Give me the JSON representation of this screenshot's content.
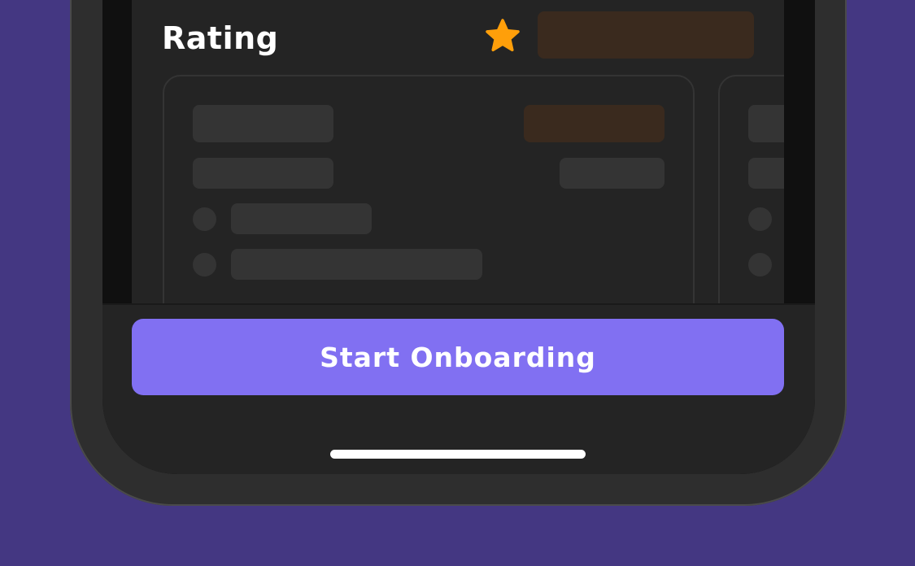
{
  "rating_section": {
    "title": "Rating",
    "star_icon": "star-icon",
    "star_color": "#FF9F0A"
  },
  "review_cards_state": "loading-skeleton",
  "footer": {
    "start_onboarding_label": "Start Onboarding"
  },
  "colors": {
    "background": "#443782",
    "primary_button": "#8170F2",
    "panel": "#242424",
    "skeleton": "#343434",
    "skeleton_accent": "#3A2A1E"
  }
}
